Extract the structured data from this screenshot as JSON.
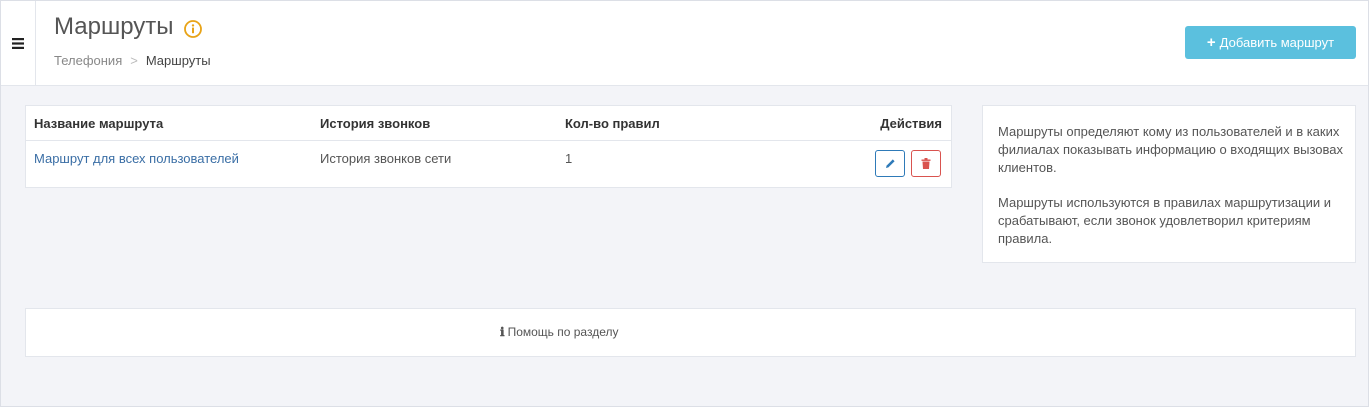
{
  "header": {
    "title": "Маршруты",
    "info_icon": "info-circle-icon",
    "breadcrumb": {
      "parent": "Телефония",
      "separator": ">",
      "current": "Маршруты"
    },
    "add_button": {
      "icon": "+",
      "label": "Добавить маршрут"
    }
  },
  "menu": {
    "icon": "hamburger-icon"
  },
  "table": {
    "columns": [
      "Название маршрута",
      "История звонков",
      "Кол-во правил",
      "Действия"
    ],
    "rows": [
      {
        "name": "Маршрут для всех пользователей",
        "history": "История звонков сети",
        "rules_count": "1",
        "actions": [
          "pencil-icon",
          "trash-icon"
        ]
      }
    ]
  },
  "info_panel": {
    "paragraph1": "Маршруты определяют кому из пользователей и в каких филиалах показывать информацию о входящих вызовах клиентов.",
    "paragraph2": "Маршруты используются в правилах маршрутизации и срабатывают, если звонок удовлетворил критериям правила."
  },
  "help": {
    "icon": "ℹ",
    "label": "Помощь по разделу"
  },
  "colors": {
    "accent_button": "#5bc0de",
    "link": "#3a6ea5",
    "edit_border": "#2e7ab8",
    "delete_border": "#d9534f",
    "info_icon": "#e8a317",
    "background": "#f3f4f8"
  }
}
